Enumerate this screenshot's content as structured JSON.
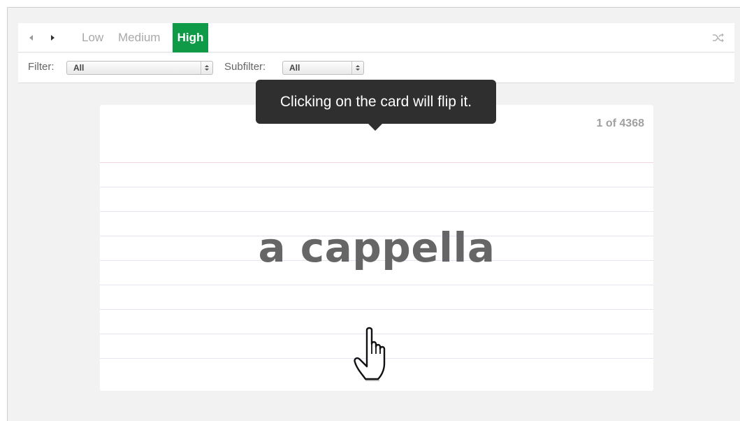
{
  "toolbar": {
    "prev_icon": "caret-left-icon",
    "next_icon": "caret-right-icon",
    "levels": [
      {
        "label": "Low",
        "active": false
      },
      {
        "label": "Medium",
        "active": false
      },
      {
        "label": "High",
        "active": true
      }
    ],
    "shuffle_icon": "shuffle-icon",
    "accent_color": "#0f9a48"
  },
  "filters": {
    "filter_label": "Filter:",
    "filter_value": "All",
    "subfilter_label": "Subfilter:",
    "subfilter_value": "All"
  },
  "tooltip": {
    "text": "Clicking on the card will flip it."
  },
  "card": {
    "counter": "1 of 4368",
    "word": "a cappella"
  },
  "cursor": {
    "icon": "hand-pointer-icon"
  }
}
